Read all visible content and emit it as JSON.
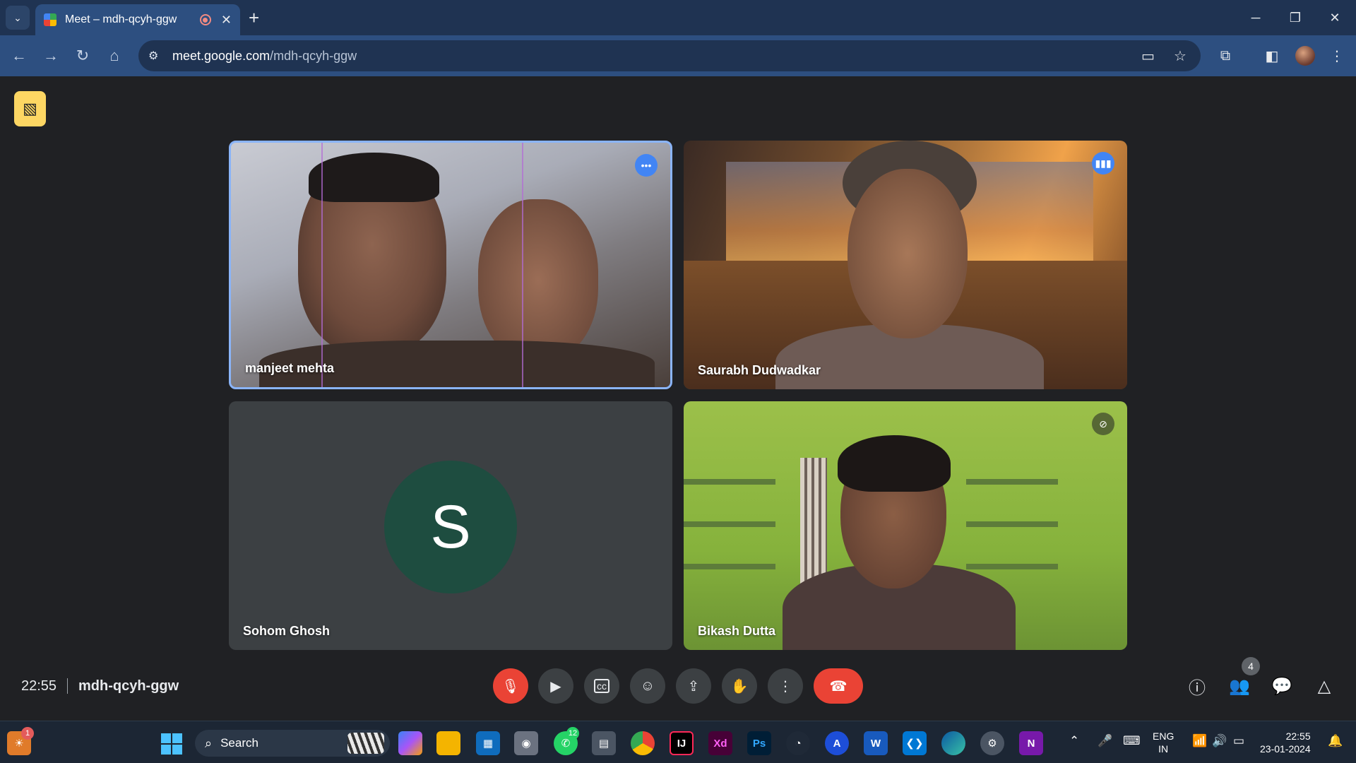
{
  "browser": {
    "tab_title": "Meet – mdh-qcyh-ggw",
    "tab_close": "✕",
    "new_tab": "+",
    "url_host": "meet.google.com",
    "url_path": "/mdh-qcyh-ggw",
    "window_controls": [
      "─",
      "❐",
      "✕"
    ]
  },
  "meet": {
    "participants": [
      {
        "name": "manjeet mehta",
        "badge": "more-options-icon",
        "speaking": true
      },
      {
        "name": "Saurabh Dudwadkar",
        "badge": "audio-level-icon"
      },
      {
        "name": "Sohom Ghosh",
        "avatar_letter": "S",
        "avatar_color": "#1e4d40"
      },
      {
        "name": "Bikash Dutta",
        "badge": "mic-off-icon"
      }
    ],
    "time": "22:55",
    "meeting_code": "mdh-qcyh-ggw",
    "people_count": "4",
    "colors": {
      "accent": "#8ab4f8",
      "danger": "#ea4335",
      "warning": "#fdd663",
      "control_bg": "#3c4043"
    }
  },
  "taskbar": {
    "search_placeholder": "Search",
    "weather_badge": "1",
    "whatsapp_badge": "12",
    "lang_top": "ENG",
    "lang_bottom": "IN",
    "clock_time": "22:55",
    "clock_date": "23-01-2024",
    "apps": [
      "copilot-icon",
      "file-explorer-icon",
      "store-icon",
      "camera-icon",
      "whatsapp-icon",
      "calculator-icon",
      "chrome-icon",
      "intellij-icon",
      "xd-icon",
      "photoshop-icon",
      "obs-icon",
      "app-icon",
      "word-icon",
      "vscode-icon",
      "edge-icon",
      "settings-icon",
      "onenote-icon"
    ],
    "app_labels": {
      "intellij": "IJ",
      "xd": "Xd",
      "photoshop": "Ps",
      "word": "W",
      "onenote": "N"
    }
  }
}
